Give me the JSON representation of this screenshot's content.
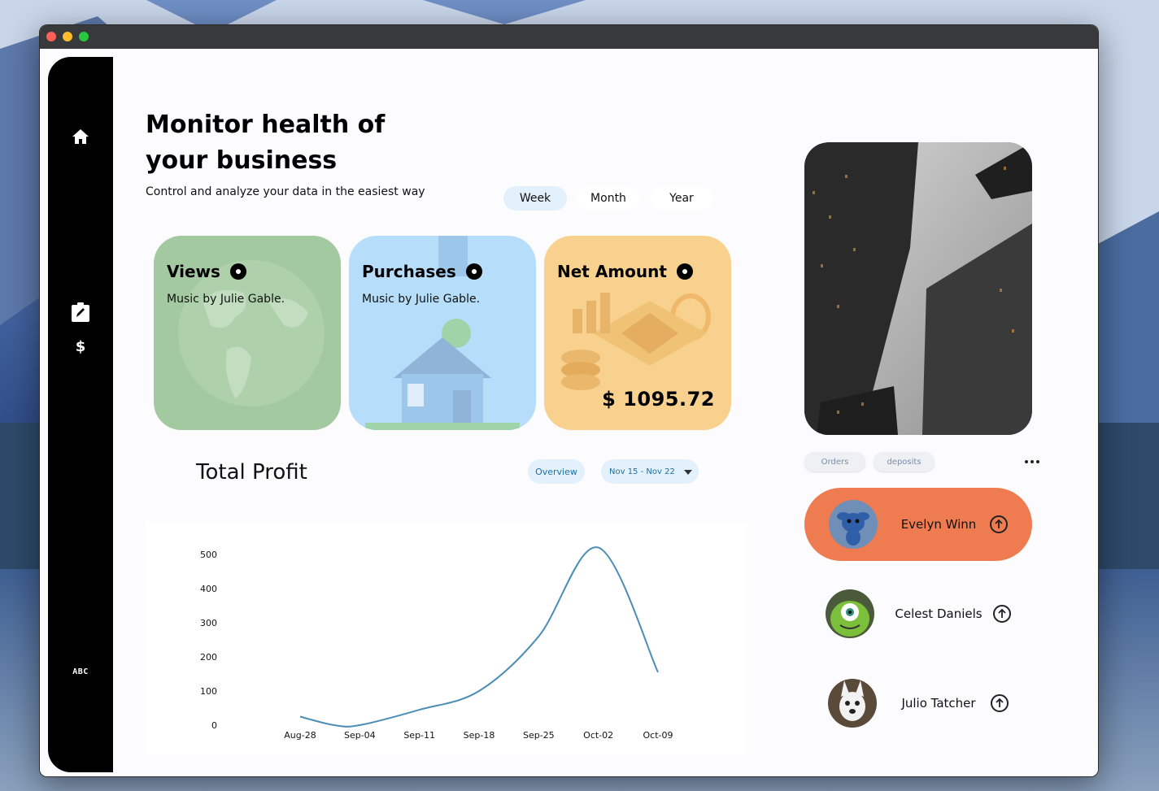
{
  "headline": "Monitor health of your business",
  "subline": "Control and analyze your data in the easiest way",
  "period_tabs": [
    "Week",
    "Month",
    "Year"
  ],
  "active_period": "Week",
  "cards": [
    {
      "title": "Views",
      "subtitle": "Music by Julie Gable.",
      "color": "#a3c9a1"
    },
    {
      "title": "Purchases",
      "subtitle": "Music by Julie Gable.",
      "color": "#b6defa"
    },
    {
      "title": "Net Amount",
      "amount": "$  1095.72",
      "color": "#f8d18e"
    }
  ],
  "profit": {
    "title": "Total Profit",
    "overview_label": "Overview",
    "date_range": "Nov 15 - Nov 22"
  },
  "chart_data": {
    "type": "line",
    "title": "",
    "xlabel": "",
    "ylabel": "",
    "x_ticks": [
      "Aug-28",
      "Sep-04",
      "Sep-11",
      "Sep-18",
      "Sep-25",
      "Oct-02",
      "Oct-09"
    ],
    "y_ticks": [
      0,
      100,
      200,
      300,
      400,
      500
    ],
    "ylim": [
      0,
      500
    ],
    "grid": false,
    "series": [
      {
        "color": "#4a8db5",
        "points": [
          {
            "x": "Aug-28",
            "y": 25
          },
          {
            "x": "Sep-01",
            "y": 0
          },
          {
            "x": "Sep-04",
            "y": 0
          },
          {
            "x": "Sep-11",
            "y": 45
          },
          {
            "x": "Sep-18",
            "y": 100
          },
          {
            "x": "Sep-25",
            "y": 260
          },
          {
            "x": "Oct-02",
            "y": 520
          },
          {
            "x": "Oct-09",
            "y": 155
          }
        ]
      }
    ]
  },
  "filters": [
    "Orders",
    "deposits"
  ],
  "people": [
    {
      "name": "Evelyn Winn",
      "active": true
    },
    {
      "name": "Celest Daniels",
      "active": false
    },
    {
      "name": "Julio Tatcher",
      "active": false
    }
  ],
  "sidebar_abc": "ABC",
  "colors": {
    "accent": "#ef7b50",
    "pill_bg": "#e2f1fc",
    "sidebar": "#000000"
  }
}
